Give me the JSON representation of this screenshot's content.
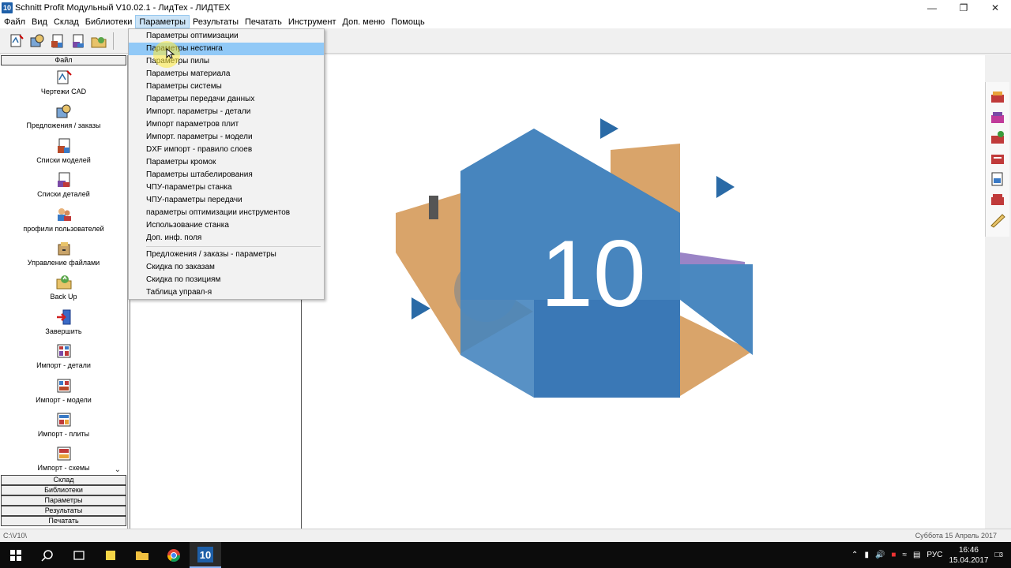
{
  "window": {
    "title": "Schnitt Profit Модульный V10.02.1 - ЛидТех - ЛИДТЕХ",
    "icon_text": "10",
    "controls": [
      "minimize-icon",
      "restore-icon",
      "close-icon"
    ]
  },
  "menubar": {
    "items": [
      "Файл",
      "Вид",
      "Склад",
      "Библиотеки",
      "Параметры",
      "Результаты",
      "Печатать",
      "Инструмент",
      "Доп. меню",
      "Помощь"
    ],
    "open_index": 4
  },
  "parameters_menu": {
    "items": [
      "Параметры оптимизации",
      "Параметры нестинга",
      "Параметры пилы",
      "Параметры материала",
      "Параметры системы",
      "Параметры передачи данных",
      "Импорт. параметры - детали",
      "Импорт параметров плит",
      "Импорт. параметры - модели",
      "DXF импорт - правило слоев",
      "Параметры кромок",
      "Параметры штабелирования",
      "ЧПУ-параметры станка",
      "ЧПУ-параметры передачи",
      "параметры оптимизации инструментов",
      "Использование станка",
      "Доп. инф. поля"
    ],
    "items_group2": [
      "Предложения / заказы - параметры",
      "Скидка по заказам",
      "Скидка по позициям",
      "Таблица управл-я"
    ],
    "highlighted_index": 1
  },
  "leftbar": {
    "active_group": "Файл",
    "items": [
      "Чертежи CAD",
      "Предложения / заказы",
      "Списки моделей",
      "Списки деталей",
      "профили пользователей",
      "Управление файлами",
      "Back Up",
      "Завершить",
      "Импорт - детали",
      "Импорт - модели",
      "Импорт - плиты",
      "Импорт - схемы"
    ],
    "other_groups": [
      "Склад",
      "Библиотеки",
      "Параметры",
      "Результаты",
      "Печатать"
    ]
  },
  "logo": {
    "text": "10",
    "colors": {
      "blue_dark": "#2a6aa6",
      "blue_light": "#4a88c0",
      "wood": "#d9a46a"
    }
  },
  "statusbar": {
    "path": "C:\\V10\\",
    "date": "Суббота 15 Апрель 2017"
  },
  "taskbar": {
    "language": "РУС",
    "time": "16:46",
    "date": "15.04.2017",
    "notifications": "3"
  }
}
